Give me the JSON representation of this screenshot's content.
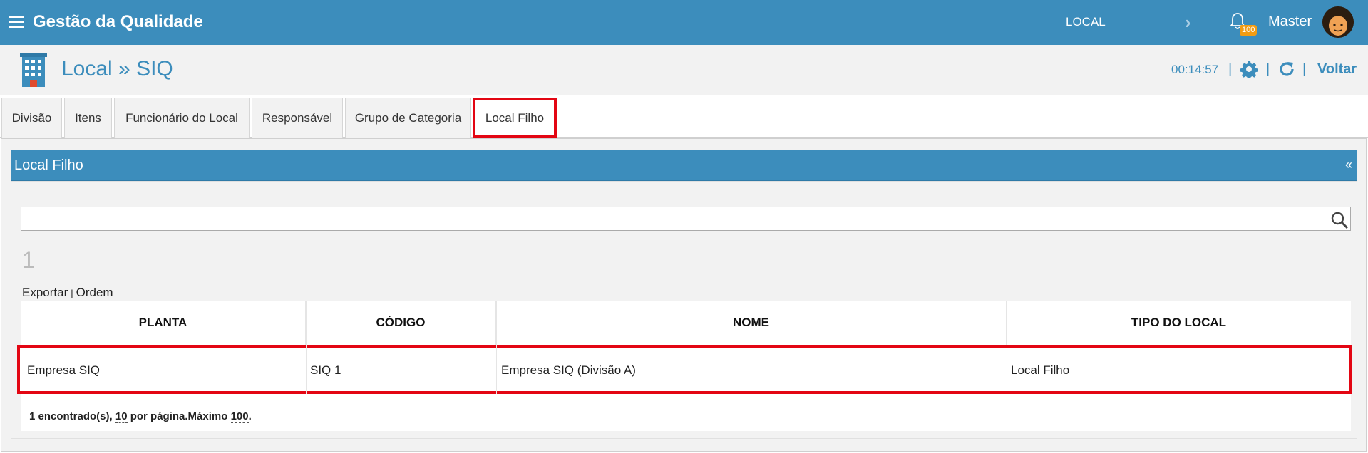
{
  "app": {
    "title": "Gestão da Qualidade"
  },
  "topbar": {
    "location_value": "LOCAL",
    "notification_count": "100",
    "user_name": "Master",
    "icons": [
      "menu-icon",
      "chevron-right-icon",
      "bell-icon",
      "avatar"
    ]
  },
  "header": {
    "title": "Local » SIQ",
    "timer": "00:14:57",
    "back_label": "Voltar",
    "icons": [
      "building-icon",
      "gear-icon",
      "refresh-icon"
    ]
  },
  "tabs": [
    {
      "label": "Divisão"
    },
    {
      "label": "Itens"
    },
    {
      "label": "Funcionário do Local"
    },
    {
      "label": "Responsável"
    },
    {
      "label": "Grupo de Categoria"
    },
    {
      "label": "Local Filho"
    }
  ],
  "panel": {
    "title": "Local Filho",
    "collapse_label": "«",
    "search_value": "",
    "count": "1",
    "actions": {
      "export": "Exportar",
      "separator": "|",
      "order": "Ordem"
    }
  },
  "table": {
    "headers": [
      "PLANTA",
      "CÓDIGO",
      "NOME",
      "TIPO DO LOCAL"
    ],
    "rows": [
      [
        "Empresa SIQ",
        "SIQ 1",
        "Empresa SIQ (Divisão A)",
        "Local Filho"
      ]
    ]
  },
  "pagination": {
    "found_text": "1 encontrado(s),",
    "per_page": "10",
    "per_page_text": "por página.Máximo",
    "max": "100",
    "end": "."
  },
  "colors": {
    "primary": "#3c8dbc",
    "highlight": "#e30613",
    "badge": "#f39c12"
  }
}
